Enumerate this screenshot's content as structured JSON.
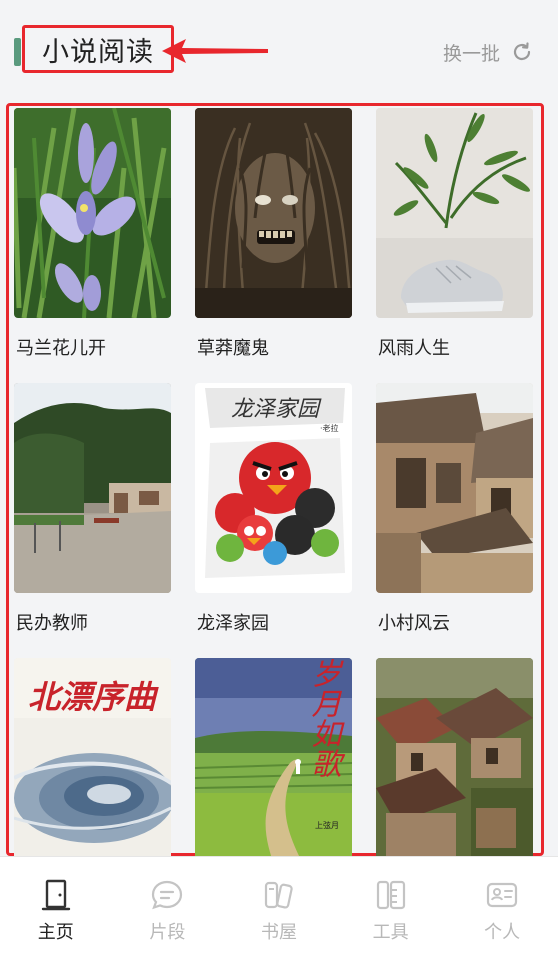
{
  "section": {
    "title": "小说阅读",
    "refresh_label": "换一批"
  },
  "books": [
    {
      "title": "马兰花儿开",
      "cover": "iris-flower-cover"
    },
    {
      "title": "草莽魔鬼",
      "cover": "long-haired-monster-cover"
    },
    {
      "title": "风雨人生",
      "cover": "bamboo-and-sneaker-cover"
    },
    {
      "title": "民办教师",
      "cover": "school-yard-cover"
    },
    {
      "title": "龙泽家园",
      "cover": "龙泽家园 · 老拉",
      "cover_text": "龙泽家园",
      "cover_sub": "·老拉"
    },
    {
      "title": "小村风云",
      "cover": "old-village-house-cover"
    },
    {
      "title": "北漂序曲",
      "cover_text": "北漂序曲",
      "hidden_title": true
    },
    {
      "title": "岁月如歌",
      "cover_text": "岁月如歌",
      "cover_sub": "上弦月",
      "hidden_title": true
    },
    {
      "title": "",
      "cover": "village-rooftops-cover",
      "hidden_title": true
    }
  ],
  "tabs": [
    {
      "label": "主页",
      "icon": "home-door-icon",
      "active": true
    },
    {
      "label": "片段",
      "icon": "chat-bubble-icon",
      "active": false
    },
    {
      "label": "书屋",
      "icon": "bookshelf-icon",
      "active": false
    },
    {
      "label": "工具",
      "icon": "tools-icon",
      "active": false
    },
    {
      "label": "个人",
      "icon": "id-card-icon",
      "active": false
    }
  ],
  "colors": {
    "annotation_red": "#e8272d",
    "accent_green": "#5a9a7e",
    "tab_active": "#222222",
    "tab_inactive": "#b8b8b8"
  }
}
